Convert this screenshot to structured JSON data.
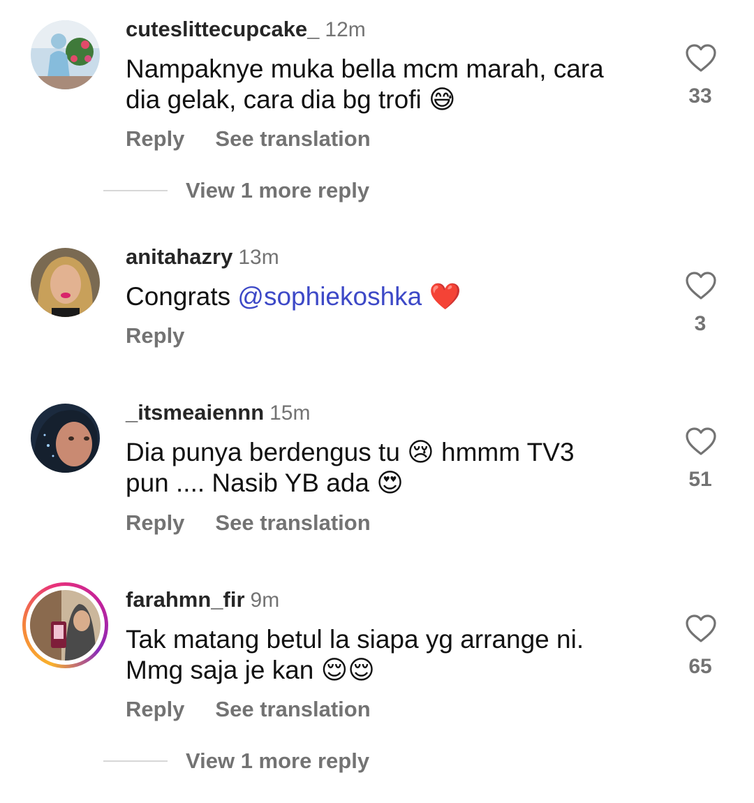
{
  "comments": [
    {
      "username": "cuteslittecupcake_",
      "time": "12m",
      "text_line1": "Nampaknye muka bella mcm marah, cara",
      "text_line2": "dia gelak, cara dia bg trofi",
      "emoji": "😅",
      "likes": "33",
      "reply_label": "Reply",
      "translate_label": "See translation",
      "view_more": "View 1 more reply",
      "avatar": "woman-in-flowers-photo"
    },
    {
      "username": "anitahazry",
      "time": "13m",
      "text_prefix": "Congrats ",
      "mention": "@sophiekoshka",
      "emoji": "❤️",
      "likes": "3",
      "reply_label": "Reply",
      "avatar": "woman-selfie-photo"
    },
    {
      "username": "_itsmeaiennn",
      "time": "15m",
      "text_line1a": "Dia punya berdengus tu ",
      "emoji1": "😢",
      "text_line1b": " hmmm TV3",
      "text_line2": "pun .... Nasib YB ada ",
      "emoji2": "😍",
      "likes": "51",
      "reply_label": "Reply",
      "translate_label": "See translation",
      "avatar": "hijab-face-photo"
    },
    {
      "username": "farahmn_fir",
      "time": "9m",
      "text_line1": "Tak matang betul la siapa yg arrange ni.",
      "text_line2": "Mmg saja je kan ",
      "emoji": "😌😌",
      "likes": "65",
      "reply_label": "Reply",
      "translate_label": "See translation",
      "view_more": "View 1 more reply",
      "avatar": "hijab-woman-story-photo"
    }
  ],
  "colors": {
    "text": "#111111",
    "muted": "#737373",
    "mention": "#3d49c7",
    "divider": "#d7d7d7"
  }
}
